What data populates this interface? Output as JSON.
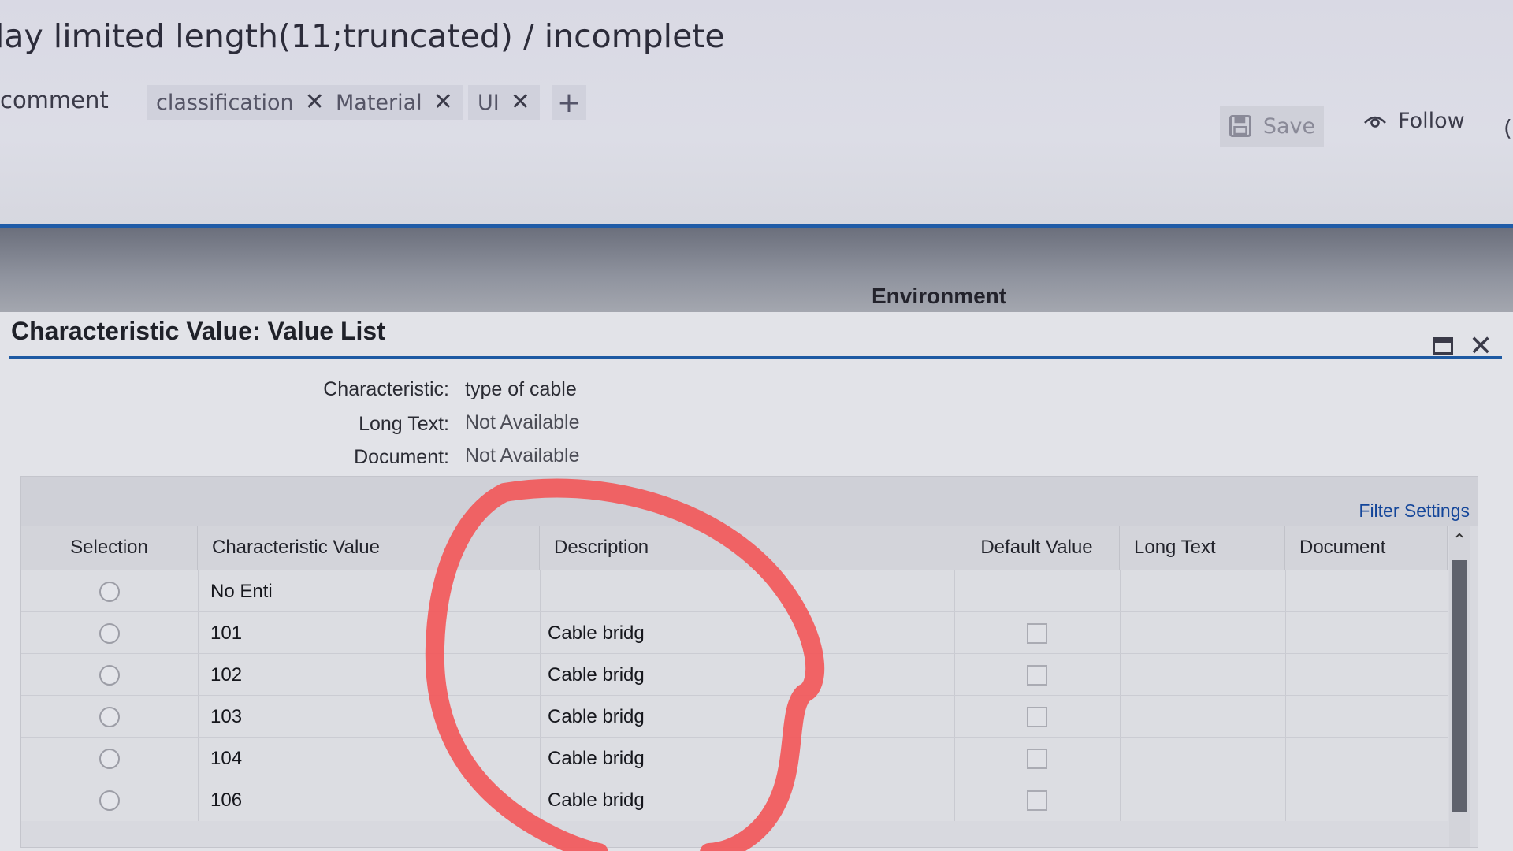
{
  "issue": {
    "title": "lay limited length(11;truncated) / incomplete",
    "comment_label": "comment",
    "tags": [
      {
        "label": "classification"
      },
      {
        "label": "Material"
      },
      {
        "label": "UI"
      }
    ],
    "add_tag": "+",
    "save_label": "Save",
    "follow_label": "Follow"
  },
  "band": {
    "environment_label": "Environment"
  },
  "dialog": {
    "title": "Characteristic Value: Value List",
    "info": {
      "characteristic_label": "Characteristic:",
      "characteristic_value": "type of cable",
      "long_text_label": "Long Text:",
      "long_text_value": "Not Available",
      "document_label": "Document:",
      "document_value": "Not Available"
    },
    "filter_settings": "Filter Settings",
    "columns": {
      "selection": "Selection",
      "characteristic_value": "Characteristic Value",
      "description": "Description",
      "default_value": "Default Value",
      "long_text": "Long Text",
      "document": "Document"
    },
    "rows": [
      {
        "value": "No Enti",
        "description": "",
        "has_checkbox": false
      },
      {
        "value": "101",
        "description": "Cable bridg",
        "has_checkbox": true
      },
      {
        "value": "102",
        "description": "Cable bridg",
        "has_checkbox": true
      },
      {
        "value": "103",
        "description": "Cable bridg",
        "has_checkbox": true
      },
      {
        "value": "104",
        "description": "Cable bridg",
        "has_checkbox": true
      },
      {
        "value": "106",
        "description": "Cable bridg",
        "has_checkbox": true
      }
    ]
  },
  "colors": {
    "accent_blue": "#1e5aa3",
    "link_blue": "#14469a",
    "annotation_red": "#f2585a"
  },
  "icons": {
    "remove_tag": "close-icon",
    "save": "floppy-disk-icon",
    "follow": "eye-icon",
    "maximize": "maximize-icon",
    "close": "close-icon",
    "scroll_up": "chevron-up-icon"
  }
}
